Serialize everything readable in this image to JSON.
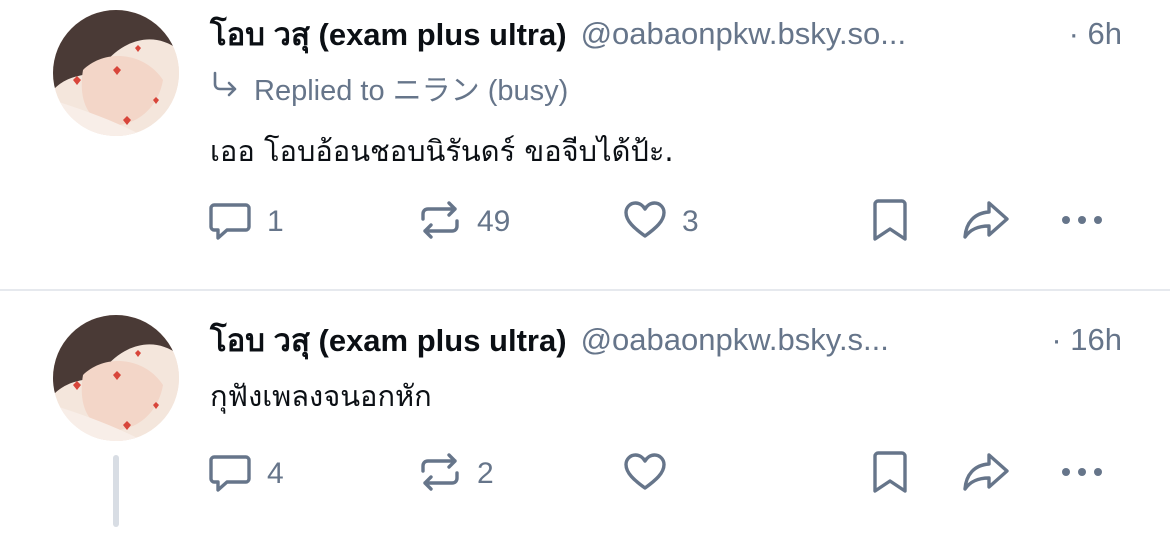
{
  "posts": [
    {
      "author": {
        "name": "โอบ วสุ (exam plus ultra)",
        "handle": "@oabaonpkw.bsky.so...",
        "avatar": "avatar-image"
      },
      "time": "· 6h",
      "reply_to": {
        "icon": "reply-arrow-icon",
        "label": "Replied to ニラン (busy)"
      },
      "text": "เออ โอบอ้อนชอบนิรันดร์ ขอจีบได้ป้ะ.",
      "actions": {
        "replies": "1",
        "reposts": "49",
        "likes": "3"
      }
    },
    {
      "author": {
        "name": "โอบ วสุ (exam plus ultra)",
        "handle": "@oabaonpkw.bsky.s...",
        "avatar": "avatar-image"
      },
      "time": "· 16h",
      "text": "กุฟังเพลงจนอกหัก",
      "actions": {
        "replies": "4",
        "reposts": "2",
        "likes": ""
      }
    }
  ],
  "icons": {
    "reply": "comment-bubble-icon",
    "repost": "repost-icon",
    "like": "heart-icon",
    "bookmark": "bookmark-icon",
    "share": "share-arrow-icon",
    "more": "more-dots-icon"
  },
  "colors": {
    "muted": "#66758a",
    "text": "#0b0f14",
    "divider": "#e6e9ee"
  }
}
